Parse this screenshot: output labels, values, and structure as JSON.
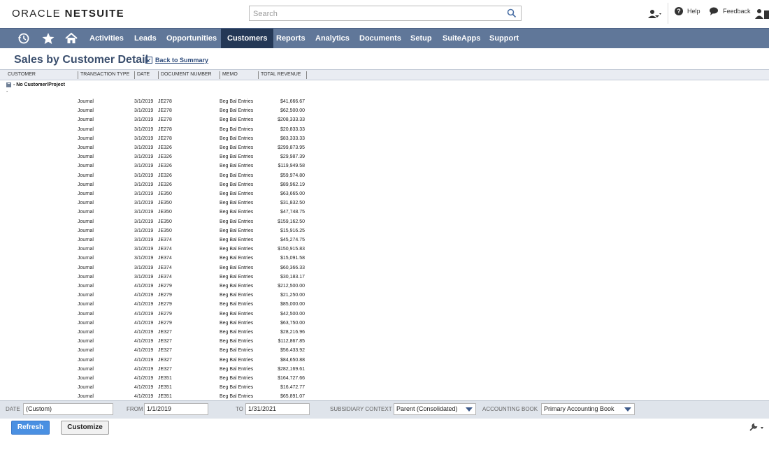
{
  "brand": {
    "part1": "ORACLE",
    "part2": "NETSUITE"
  },
  "search": {
    "placeholder": "Search",
    "value": ""
  },
  "header_right": {
    "help_label": "Help",
    "feedback_label": "Feedback"
  },
  "nav": {
    "tabs": [
      {
        "label": "Activities"
      },
      {
        "label": "Leads"
      },
      {
        "label": "Opportunities"
      },
      {
        "label": "Customers",
        "active": true
      },
      {
        "label": "Reports"
      },
      {
        "label": "Analytics"
      },
      {
        "label": "Documents"
      },
      {
        "label": "Setup"
      },
      {
        "label": "SuiteApps"
      },
      {
        "label": "Support"
      }
    ]
  },
  "page": {
    "title": "Sales by Customer Detail",
    "back_link": "Back to Summary"
  },
  "table": {
    "columns": [
      "CUSTOMER",
      "TRANSACTION TYPE",
      "DATE",
      "DOCUMENT NUMBER",
      "MEMO",
      "TOTAL REVENUE"
    ],
    "group_label": "- No Customer/Project",
    "group_dash": "-",
    "rows": [
      {
        "type": "Journal",
        "date": "3/1/2019",
        "doc": "JE278",
        "memo": "Beg Bal Entries",
        "revenue": "$41,666.67"
      },
      {
        "type": "Journal",
        "date": "3/1/2019",
        "doc": "JE278",
        "memo": "Beg Bal Entries",
        "revenue": "$62,500.00"
      },
      {
        "type": "Journal",
        "date": "3/1/2019",
        "doc": "JE278",
        "memo": "Beg Bal Entries",
        "revenue": "$208,333.33"
      },
      {
        "type": "Journal",
        "date": "3/1/2019",
        "doc": "JE278",
        "memo": "Beg Bal Entries",
        "revenue": "$20,833.33"
      },
      {
        "type": "Journal",
        "date": "3/1/2019",
        "doc": "JE278",
        "memo": "Beg Bal Entries",
        "revenue": "$83,333.33"
      },
      {
        "type": "Journal",
        "date": "3/1/2019",
        "doc": "JE326",
        "memo": "Beg Bal Entries",
        "revenue": "$299,873.95"
      },
      {
        "type": "Journal",
        "date": "3/1/2019",
        "doc": "JE326",
        "memo": "Beg Bal Entries",
        "revenue": "$29,987.39"
      },
      {
        "type": "Journal",
        "date": "3/1/2019",
        "doc": "JE326",
        "memo": "Beg Bal Entries",
        "revenue": "$119,949.58"
      },
      {
        "type": "Journal",
        "date": "3/1/2019",
        "doc": "JE326",
        "memo": "Beg Bal Entries",
        "revenue": "$59,974.80"
      },
      {
        "type": "Journal",
        "date": "3/1/2019",
        "doc": "JE326",
        "memo": "Beg Bal Entries",
        "revenue": "$89,962.19"
      },
      {
        "type": "Journal",
        "date": "3/1/2019",
        "doc": "JE350",
        "memo": "Beg Bal Entries",
        "revenue": "$63,665.00"
      },
      {
        "type": "Journal",
        "date": "3/1/2019",
        "doc": "JE350",
        "memo": "Beg Bal Entries",
        "revenue": "$31,832.50"
      },
      {
        "type": "Journal",
        "date": "3/1/2019",
        "doc": "JE350",
        "memo": "Beg Bal Entries",
        "revenue": "$47,748.75"
      },
      {
        "type": "Journal",
        "date": "3/1/2019",
        "doc": "JE350",
        "memo": "Beg Bal Entries",
        "revenue": "$159,162.50"
      },
      {
        "type": "Journal",
        "date": "3/1/2019",
        "doc": "JE350",
        "memo": "Beg Bal Entries",
        "revenue": "$15,916.25"
      },
      {
        "type": "Journal",
        "date": "3/1/2019",
        "doc": "JE374",
        "memo": "Beg Bal Entries",
        "revenue": "$45,274.75"
      },
      {
        "type": "Journal",
        "date": "3/1/2019",
        "doc": "JE374",
        "memo": "Beg Bal Entries",
        "revenue": "$150,915.83"
      },
      {
        "type": "Journal",
        "date": "3/1/2019",
        "doc": "JE374",
        "memo": "Beg Bal Entries",
        "revenue": "$15,091.58"
      },
      {
        "type": "Journal",
        "date": "3/1/2019",
        "doc": "JE374",
        "memo": "Beg Bal Entries",
        "revenue": "$60,366.33"
      },
      {
        "type": "Journal",
        "date": "3/1/2019",
        "doc": "JE374",
        "memo": "Beg Bal Entries",
        "revenue": "$30,183.17"
      },
      {
        "type": "Journal",
        "date": "4/1/2019",
        "doc": "JE279",
        "memo": "Beg Bal Entries",
        "revenue": "$212,500.00"
      },
      {
        "type": "Journal",
        "date": "4/1/2019",
        "doc": "JE279",
        "memo": "Beg Bal Entries",
        "revenue": "$21,250.00"
      },
      {
        "type": "Journal",
        "date": "4/1/2019",
        "doc": "JE279",
        "memo": "Beg Bal Entries",
        "revenue": "$85,000.00"
      },
      {
        "type": "Journal",
        "date": "4/1/2019",
        "doc": "JE279",
        "memo": "Beg Bal Entries",
        "revenue": "$42,500.00"
      },
      {
        "type": "Journal",
        "date": "4/1/2019",
        "doc": "JE279",
        "memo": "Beg Bal Entries",
        "revenue": "$63,750.00"
      },
      {
        "type": "Journal",
        "date": "4/1/2019",
        "doc": "JE327",
        "memo": "Beg Bal Entries",
        "revenue": "$28,216.96"
      },
      {
        "type": "Journal",
        "date": "4/1/2019",
        "doc": "JE327",
        "memo": "Beg Bal Entries",
        "revenue": "$112,867.85"
      },
      {
        "type": "Journal",
        "date": "4/1/2019",
        "doc": "JE327",
        "memo": "Beg Bal Entries",
        "revenue": "$56,433.92"
      },
      {
        "type": "Journal",
        "date": "4/1/2019",
        "doc": "JE327",
        "memo": "Beg Bal Entries",
        "revenue": "$84,650.88"
      },
      {
        "type": "Journal",
        "date": "4/1/2019",
        "doc": "JE327",
        "memo": "Beg Bal Entries",
        "revenue": "$282,169.61"
      },
      {
        "type": "Journal",
        "date": "4/1/2019",
        "doc": "JE351",
        "memo": "Beg Bal Entries",
        "revenue": "$164,727.66"
      },
      {
        "type": "Journal",
        "date": "4/1/2019",
        "doc": "JE351",
        "memo": "Beg Bal Entries",
        "revenue": "$16,472.77"
      },
      {
        "type": "Journal",
        "date": "4/1/2019",
        "doc": "JE351",
        "memo": "Beg Bal Entries",
        "revenue": "$65,891.07"
      }
    ]
  },
  "filters": {
    "date_label": "DATE",
    "date_value": "(Custom)",
    "from_label": "FROM",
    "from_value": "1/1/2019",
    "to_label": "TO",
    "to_value": "1/31/2021",
    "subsidiary_label": "SUBSIDIARY CONTEXT",
    "subsidiary_value": "Parent (Consolidated)",
    "book_label": "ACCOUNTING BOOK",
    "book_value": "Primary Accounting Book"
  },
  "buttons": {
    "refresh": "Refresh",
    "customize": "Customize"
  },
  "colors": {
    "nav_bg": "#607799",
    "nav_active": "#243856",
    "title": "#3b4f6e",
    "primary_button": "#4a90e2"
  },
  "icons": [
    "search-icon",
    "recent-icon",
    "star-icon",
    "home-icon",
    "user-switch-icon",
    "help-icon",
    "feedback-icon",
    "profile-icon",
    "back-to-summary-icon",
    "collapse-icon",
    "wrench-icon"
  ]
}
